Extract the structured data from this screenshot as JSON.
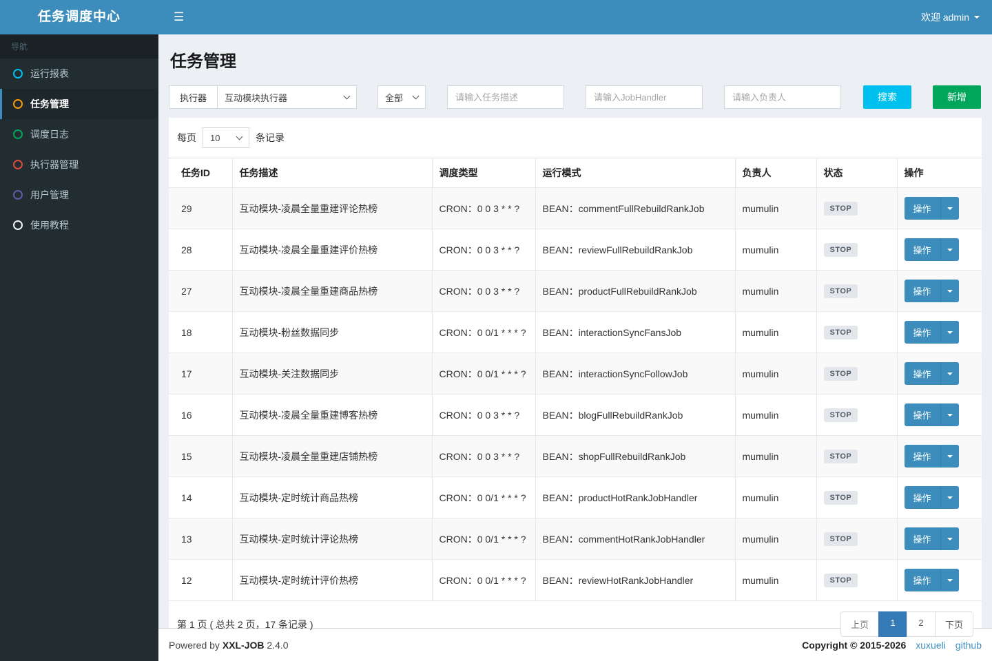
{
  "header": {
    "brand": "任务调度中心",
    "hamburger_icon": "menu-toggle",
    "welcome": "欢迎 admin"
  },
  "sidebar": {
    "nav_label": "导航",
    "items": [
      {
        "id": "report",
        "label": "运行报表",
        "icon": "circle-o-icon",
        "icon_color": "#00c0ef",
        "active": false
      },
      {
        "id": "jobinfo",
        "label": "任务管理",
        "icon": "circle-o-icon",
        "icon_color": "#f39c12",
        "active": true
      },
      {
        "id": "joblog",
        "label": "调度日志",
        "icon": "circle-o-icon",
        "icon_color": "#00a65a",
        "active": false
      },
      {
        "id": "jobgroup",
        "label": "执行器管理",
        "icon": "circle-o-icon",
        "icon_color": "#dd4b39",
        "active": false
      },
      {
        "id": "user",
        "label": "用户管理",
        "icon": "circle-o-icon",
        "icon_color": "#605ca8",
        "active": false
      },
      {
        "id": "help",
        "label": "使用教程",
        "icon": "circle-o-icon",
        "icon_color": "#f5f5f5",
        "active": false
      }
    ]
  },
  "page": {
    "title": "任务管理"
  },
  "filters": {
    "executor_label": "执行器",
    "executor_value": "互动模块执行器",
    "status_value": "全部",
    "desc_placeholder": "请输入任务描述",
    "handler_placeholder": "请输入JobHandler",
    "author_placeholder": "请输入负责人",
    "search_label": "搜索",
    "add_label": "新增"
  },
  "pager_top": {
    "prefix": "每页",
    "size": "10",
    "suffix": "条记录"
  },
  "table": {
    "columns": [
      "任务ID",
      "任务描述",
      "调度类型",
      "运行模式",
      "负责人",
      "状态",
      "操作"
    ],
    "action_label": "操作",
    "rows": [
      {
        "id": "29",
        "desc": "互动模块-凌晨全量重建评论热榜",
        "cron": "CRON：0 0 3 * * ?",
        "mode": "BEAN：commentFullRebuildRankJob",
        "author": "mumulin",
        "status": "STOP"
      },
      {
        "id": "28",
        "desc": "互动模块-凌晨全量重建评价热榜",
        "cron": "CRON：0 0 3 * * ?",
        "mode": "BEAN：reviewFullRebuildRankJob",
        "author": "mumulin",
        "status": "STOP"
      },
      {
        "id": "27",
        "desc": "互动模块-凌晨全量重建商品热榜",
        "cron": "CRON：0 0 3 * * ?",
        "mode": "BEAN：productFullRebuildRankJob",
        "author": "mumulin",
        "status": "STOP"
      },
      {
        "id": "18",
        "desc": "互动模块-粉丝数据同步",
        "cron": "CRON：0 0/1 * * * ?",
        "mode": "BEAN：interactionSyncFansJob",
        "author": "mumulin",
        "status": "STOP"
      },
      {
        "id": "17",
        "desc": "互动模块-关注数据同步",
        "cron": "CRON：0 0/1 * * * ?",
        "mode": "BEAN：interactionSyncFollowJob",
        "author": "mumulin",
        "status": "STOP"
      },
      {
        "id": "16",
        "desc": "互动模块-凌晨全量重建博客热榜",
        "cron": "CRON：0 0 3 * * ?",
        "mode": "BEAN：blogFullRebuildRankJob",
        "author": "mumulin",
        "status": "STOP"
      },
      {
        "id": "15",
        "desc": "互动模块-凌晨全量重建店铺热榜",
        "cron": "CRON：0 0 3 * * ?",
        "mode": "BEAN：shopFullRebuildRankJob",
        "author": "mumulin",
        "status": "STOP"
      },
      {
        "id": "14",
        "desc": "互动模块-定时统计商品热榜",
        "cron": "CRON：0 0/1 * * * ?",
        "mode": "BEAN：productHotRankJobHandler",
        "author": "mumulin",
        "status": "STOP"
      },
      {
        "id": "13",
        "desc": "互动模块-定时统计评论热榜",
        "cron": "CRON：0 0/1 * * * ?",
        "mode": "BEAN：commentHotRankJobHandler",
        "author": "mumulin",
        "status": "STOP"
      },
      {
        "id": "12",
        "desc": "互动模块-定时统计评价热榜",
        "cron": "CRON：0 0/1 * * * ?",
        "mode": "BEAN：reviewHotRankJobHandler",
        "author": "mumulin",
        "status": "STOP"
      }
    ]
  },
  "pagination": {
    "info": "第 1 页 ( 总共 2 页，17 条记录 )",
    "prev": "上页",
    "pages": [
      "1",
      "2"
    ],
    "active_page": "1",
    "next": "下页"
  },
  "footer": {
    "powered_prefix": "Powered by",
    "brand": "XXL-JOB",
    "version": "2.4.0",
    "copyright": "Copyright © 2015-2026",
    "links": [
      "xuxueli",
      "github"
    ]
  },
  "colors": {
    "header_bg": "#3c8dbc",
    "sidebar_bg": "#222d32",
    "search_button": "#00c0ef",
    "add_button": "#00a65a",
    "action_button": "#3c8dbc",
    "pagination_active": "#337ab7",
    "status_badge_bg": "#e3e7eb"
  }
}
